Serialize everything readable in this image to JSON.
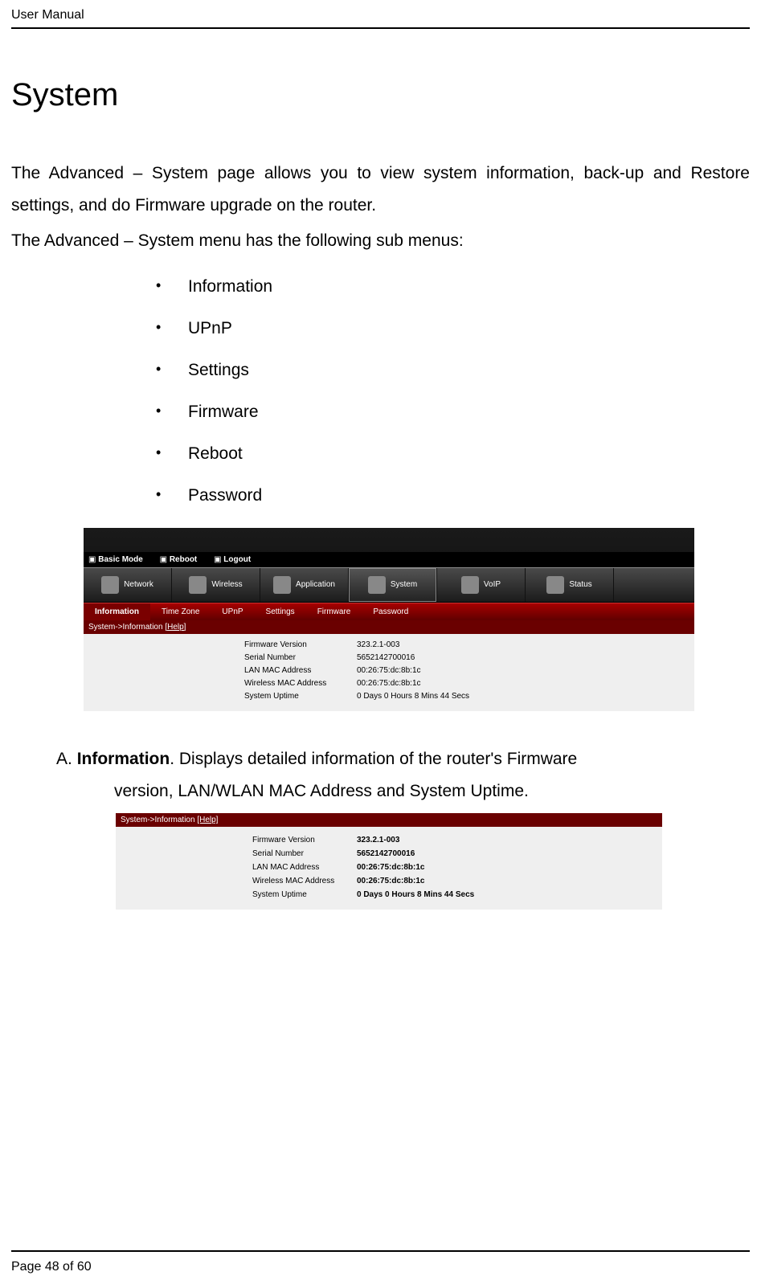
{
  "header": {
    "title": "User Manual"
  },
  "page": {
    "heading": "System",
    "intro_a": "The Advanced – System page allows you to view system information, back-up and Restore settings, and do Firmware upgrade on the router.",
    "intro_b": "The Advanced – System menu has the following sub menus:"
  },
  "submenus": {
    "items": [
      "Information",
      "UPnP",
      "Settings",
      "Firmware",
      "Reboot",
      "Password"
    ]
  },
  "router": {
    "linkbar": {
      "basic": "Basic Mode",
      "reboot": "Reboot",
      "logout": "Logout"
    },
    "tabs": {
      "network": "Network",
      "wireless": "Wireless",
      "application": "Application",
      "system": "System",
      "voip": "VoIP",
      "status": "Status"
    },
    "rednav": {
      "information": "Information",
      "timezone": "Time Zone",
      "upnp": "UPnP",
      "settings": "Settings",
      "firmware": "Firmware",
      "password": "Password"
    },
    "breadcrumb_prefix": "System->Information ",
    "breadcrumb_help": "[Help]",
    "info": {
      "fw_label": "Firmware Version",
      "fw_val": "323.2.1-003",
      "sn_label": "Serial Number",
      "sn_val": "5652142700016",
      "lan_label": "LAN MAC Address",
      "lan_val": "00:26:75:dc:8b:1c",
      "wlan_label": "Wireless MAC Address",
      "wlan_val": "00:26:75:dc:8b:1c",
      "up_label": "System Uptime",
      "up_val": "0 Days 0 Hours 8 Mins 44 Secs"
    }
  },
  "sectionA": {
    "label": "A.",
    "title": "Information",
    "line1_rest": ". Displays detailed information of the router's Firmware",
    "line2": "version, LAN/WLAN MAC Address and System Uptime."
  },
  "footer": {
    "page_label": "Page 48",
    "of_label": " of 60"
  }
}
